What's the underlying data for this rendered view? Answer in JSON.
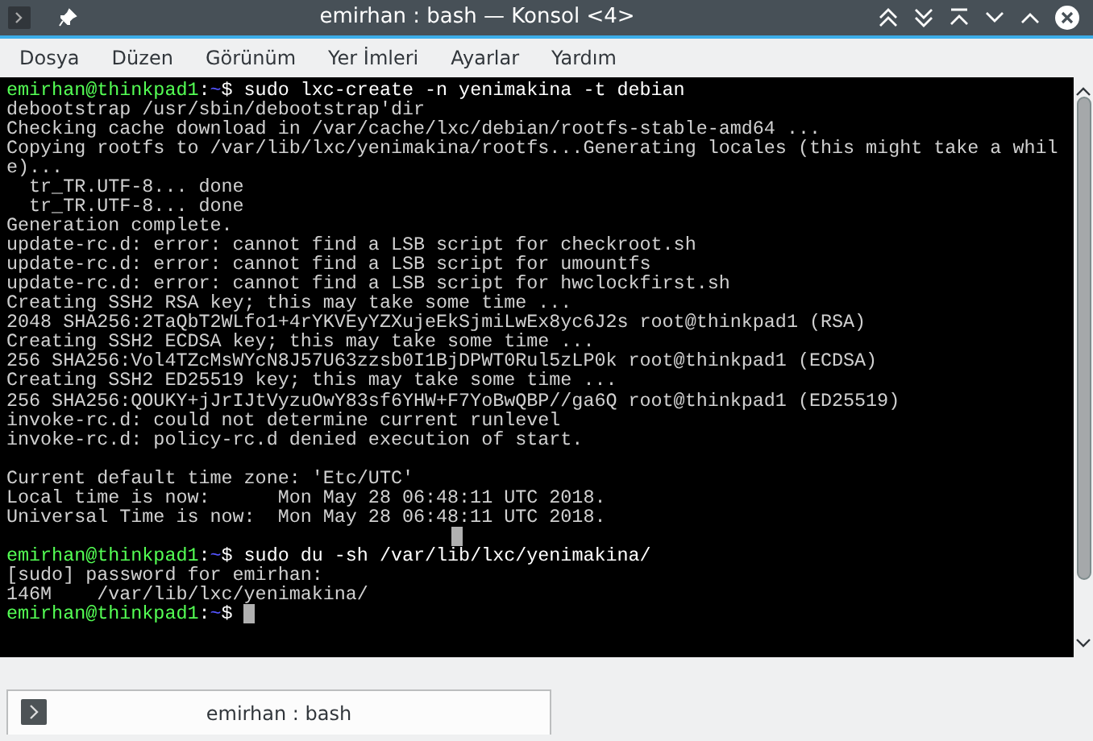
{
  "window": {
    "title": "emirhan : bash — Konsol <4>"
  },
  "menu": [
    "Dosya",
    "Düzen",
    "Görünüm",
    "Yer İmleri",
    "Ayarlar",
    "Yardım"
  ],
  "terminal": {
    "lines": [
      {
        "kind": "text",
        "segments": [
          {
            "text": "emirhan@thinkpad1",
            "color": "#54ff54"
          },
          {
            "text": ":",
            "color": "#ffffff"
          },
          {
            "text": "~",
            "color": "#5454ff"
          },
          {
            "text": "$ sudo lxc-create -n yenimakina -t debian",
            "color": "#ffffff"
          }
        ]
      },
      {
        "kind": "text",
        "segments": [
          {
            "text": "debootstrap /usr/sbin/debootstrap'dir",
            "color": "#d0d0d0"
          }
        ]
      },
      {
        "kind": "text",
        "segments": [
          {
            "text": "Checking cache download in /var/cache/lxc/debian/rootfs-stable-amd64 ...",
            "color": "#d0d0d0"
          }
        ]
      },
      {
        "kind": "text",
        "segments": [
          {
            "text": "Copying rootfs to /var/lib/lxc/yenimakina/rootfs...Generating locales (this might take a whil",
            "color": "#d0d0d0"
          }
        ]
      },
      {
        "kind": "text",
        "segments": [
          {
            "text": "e)...",
            "color": "#d0d0d0"
          }
        ]
      },
      {
        "kind": "text",
        "segments": [
          {
            "text": "  tr_TR.UTF-8... done",
            "color": "#d0d0d0"
          }
        ]
      },
      {
        "kind": "text",
        "segments": [
          {
            "text": "  tr_TR.UTF-8... done",
            "color": "#d0d0d0"
          }
        ]
      },
      {
        "kind": "text",
        "segments": [
          {
            "text": "Generation complete.",
            "color": "#d0d0d0"
          }
        ]
      },
      {
        "kind": "text",
        "segments": [
          {
            "text": "update-rc.d: error: cannot find a LSB script for checkroot.sh",
            "color": "#d0d0d0"
          }
        ]
      },
      {
        "kind": "text",
        "segments": [
          {
            "text": "update-rc.d: error: cannot find a LSB script for umountfs",
            "color": "#d0d0d0"
          }
        ]
      },
      {
        "kind": "text",
        "segments": [
          {
            "text": "update-rc.d: error: cannot find a LSB script for hwclockfirst.sh",
            "color": "#d0d0d0"
          }
        ]
      },
      {
        "kind": "text",
        "segments": [
          {
            "text": "Creating SSH2 RSA key; this may take some time ...",
            "color": "#d0d0d0"
          }
        ]
      },
      {
        "kind": "text",
        "segments": [
          {
            "text": "2048 SHA256:2TaQbT2WLfo1+4rYKVEyYZXujeEkSjmiLwEx8yc6J2s root@thinkpad1 (RSA)",
            "color": "#d0d0d0"
          }
        ]
      },
      {
        "kind": "text",
        "segments": [
          {
            "text": "Creating SSH2 ECDSA key; this may take some time ...",
            "color": "#d0d0d0"
          }
        ]
      },
      {
        "kind": "text",
        "segments": [
          {
            "text": "256 SHA256:Vol4TZcMsWYcN8J57U63zzsb0I1BjDPWT0Rul5zLP0k root@thinkpad1 (ECDSA)",
            "color": "#d0d0d0"
          }
        ]
      },
      {
        "kind": "text",
        "segments": [
          {
            "text": "Creating SSH2 ED25519 key; this may take some time ...",
            "color": "#d0d0d0"
          }
        ]
      },
      {
        "kind": "text",
        "segments": [
          {
            "text": "256 SHA256:QOUKY+jJrIJtVyzuOwY83sf6YHW+F7YoBwQBP//ga6Q root@thinkpad1 (ED25519)",
            "color": "#d0d0d0"
          }
        ]
      },
      {
        "kind": "text",
        "segments": [
          {
            "text": "invoke-rc.d: could not determine current runlevel",
            "color": "#d0d0d0"
          }
        ]
      },
      {
        "kind": "text",
        "segments": [
          {
            "text": "invoke-rc.d: policy-rc.d denied execution of start.",
            "color": "#d0d0d0"
          }
        ]
      },
      {
        "kind": "blank"
      },
      {
        "kind": "text",
        "segments": [
          {
            "text": "Current default time zone: 'Etc/UTC'",
            "color": "#d0d0d0"
          }
        ]
      },
      {
        "kind": "text",
        "segments": [
          {
            "text": "Local time is now:      Mon May 28 06:48:11 UTC 2018.",
            "color": "#d0d0d0"
          }
        ]
      },
      {
        "kind": "text",
        "segments": [
          {
            "text": "Universal Time is now:  Mon May 28 06:48:11 UTC 2018.",
            "color": "#d0d0d0"
          }
        ]
      },
      {
        "kind": "blank",
        "cursor": true
      },
      {
        "kind": "text",
        "segments": [
          {
            "text": "emirhan@thinkpad1",
            "color": "#54ff54"
          },
          {
            "text": ":",
            "color": "#ffffff"
          },
          {
            "text": "~",
            "color": "#5454ff"
          },
          {
            "text": "$ sudo du -sh /var/lib/lxc/yenimakina/",
            "color": "#ffffff"
          }
        ]
      },
      {
        "kind": "text",
        "segments": [
          {
            "text": "[sudo] password for emirhan:",
            "color": "#d0d0d0"
          }
        ]
      },
      {
        "kind": "text",
        "segments": [
          {
            "text": "146M    /var/lib/lxc/yenimakina/",
            "color": "#d0d0d0"
          }
        ]
      },
      {
        "kind": "text",
        "segments": [
          {
            "text": "emirhan@thinkpad1",
            "color": "#54ff54"
          },
          {
            "text": ":",
            "color": "#ffffff"
          },
          {
            "text": "~",
            "color": "#5454ff"
          },
          {
            "text": "$ ",
            "color": "#ffffff"
          }
        ],
        "cursor": true
      }
    ]
  },
  "tabs": [
    {
      "label": "emirhan : bash",
      "selected": true
    }
  ]
}
